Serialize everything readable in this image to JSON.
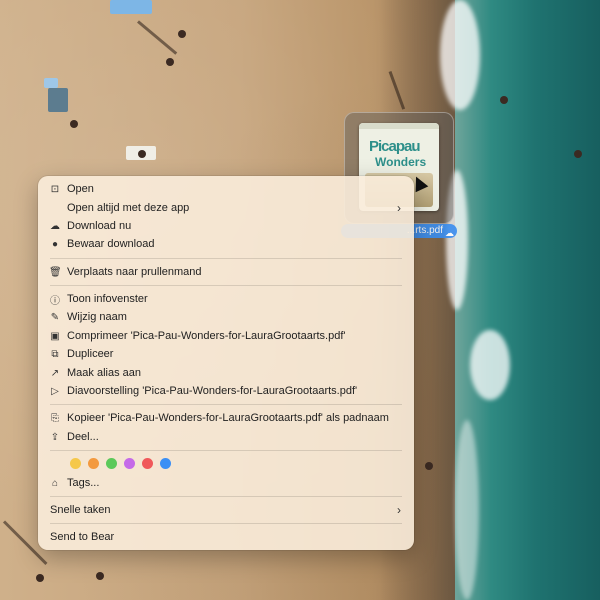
{
  "file": {
    "name_label": "...rts.pdf",
    "thumbnail_title_line1": "Picapau",
    "thumbnail_title_line2": "Wonders"
  },
  "menu": {
    "items": [
      {
        "label": "Open",
        "icon": "open-icon"
      },
      {
        "label": "Open altijd met deze app",
        "icon": "none",
        "submenu": true
      },
      {
        "label": "Download nu",
        "icon": "cloud-download-icon"
      },
      {
        "label": "Bewaar download",
        "icon": "download-circle-icon"
      },
      {
        "label": "Verplaats naar prullenmand",
        "icon": "trash-icon"
      },
      {
        "label": "Toon infovenster",
        "icon": "info-icon"
      },
      {
        "label": "Wijzig naam",
        "icon": "pencil-icon"
      },
      {
        "label": "Comprimeer 'Pica-Pau-Wonders-for-LauraGrootaarts.pdf'",
        "icon": "archive-icon"
      },
      {
        "label": "Dupliceer",
        "icon": "duplicate-icon"
      },
      {
        "label": "Maak alias aan",
        "icon": "alias-icon"
      },
      {
        "label": "Diavoorstelling 'Pica-Pau-Wonders-for-LauraGrootaarts.pdf'",
        "icon": "slideshow-icon"
      },
      {
        "label": "Kopieer 'Pica-Pau-Wonders-for-LauraGrootaarts.pdf' als padnaam",
        "icon": "copy-path-icon"
      },
      {
        "label": "Deel...",
        "icon": "share-icon"
      }
    ],
    "tag_colors": [
      "#f5c84a",
      "#f39a3f",
      "#5cc95a",
      "#c56ae8",
      "#f0585a",
      "#3b8ff5"
    ],
    "tags_label": "Tags...",
    "quick_actions_label": "Snelle taken",
    "send_to_bear_label": "Send to Bear"
  }
}
